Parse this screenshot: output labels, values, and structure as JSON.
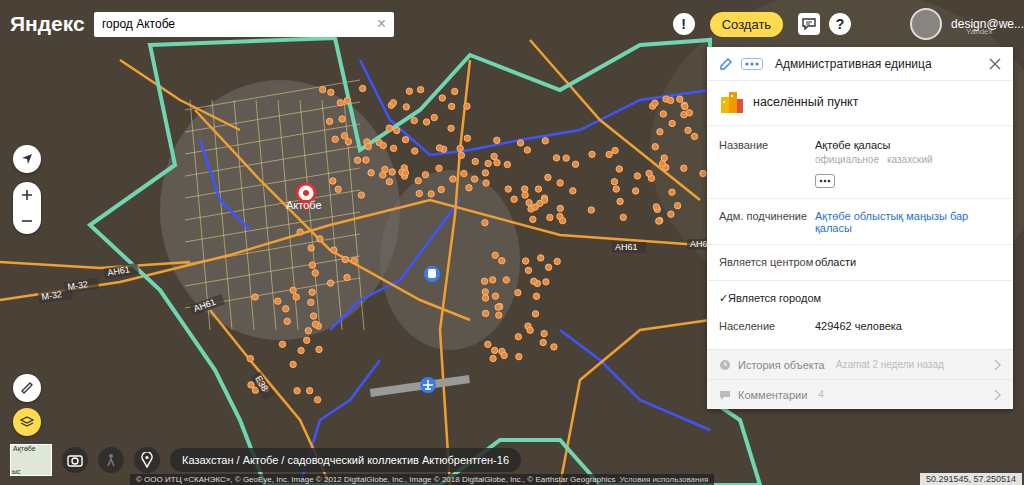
{
  "header": {
    "logo": "Яндекс",
    "search": {
      "value": "город Актобе",
      "clear": "×"
    },
    "alert": "!",
    "create_button": "Создать",
    "help": "?",
    "user": "design@we..."
  },
  "map": {
    "watermark": "Yandex",
    "city_label": "Актобе",
    "road_labels": [
      "M-32",
      "M-32",
      "AH61",
      "AH61",
      "AH61",
      "AH6",
      "E38"
    ]
  },
  "minimap": {
    "labels": [
      "Ақтөбе",
      "ыс"
    ]
  },
  "breadcrumb": "Казахстан / Актобе / садоводческий коллектив Актюбрентген-16",
  "copyright": "© ООО ИТЦ «СКАНЭКС», © GeoEye, Inc. Image © 2012 DigitalGlobe, Inc., Image © 2018 DigitalGlobe, Inc., © Earthstar Geographics",
  "terms": "Условия использования",
  "coordinates": "50.291545, 57.250514",
  "panel": {
    "title": "Административная единица",
    "type": "населённый пункт",
    "fields": [
      {
        "kind": "name",
        "label": "Название",
        "value": "Ақтөбе қаласы",
        "notes": [
          "официальное",
          "казахский"
        ]
      },
      {
        "kind": "link",
        "label": "Адм. подчинение",
        "value": "Ақтөбе облыстық маңызы бар қаласы"
      },
      {
        "kind": "text",
        "label": "Является центром",
        "value": "области"
      },
      {
        "kind": "check",
        "mark": "✓",
        "label": "Является городом",
        "checked": true
      },
      {
        "kind": "text",
        "label": "Население",
        "value": "429462 человека"
      }
    ],
    "footer": [
      {
        "label": "История объекта",
        "meta": "Azamat 2 недели назад"
      },
      {
        "label": "Комментарии",
        "meta": "4"
      }
    ]
  }
}
